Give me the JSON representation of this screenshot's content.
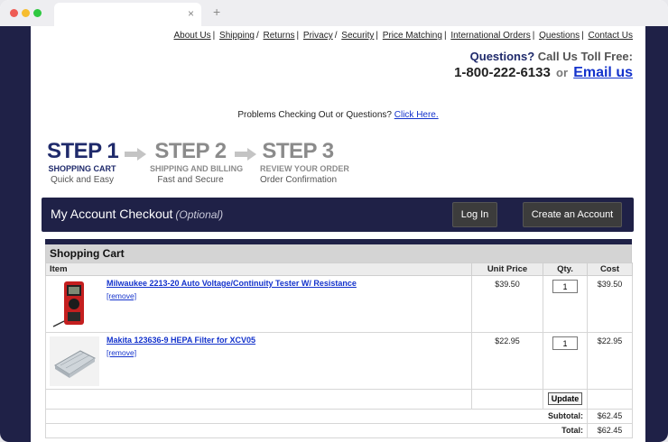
{
  "browser": {
    "tab_close": "×",
    "new_tab": "+"
  },
  "toplinks": [
    "About Us",
    "Shipping",
    "Returns",
    "Privacy",
    "Security",
    "Price Matching",
    "International Orders",
    "Questions",
    "Contact Us"
  ],
  "toll": {
    "questions": "Questions?",
    "call_text": " Call Us Toll Free:",
    "phone": "1-800-222-6133",
    "or": "or",
    "email_link": "Email us"
  },
  "problems": {
    "text": "Problems Checking Out or Questions? ",
    "link": "Click Here."
  },
  "steps": [
    {
      "big": "STEP 1",
      "sub": "SHOPPING CART",
      "desc": "Quick and Easy"
    },
    {
      "big": "STEP 2",
      "sub": "SHIPPING AND BILLING",
      "desc": "Fast and Secure"
    },
    {
      "big": "STEP 3",
      "sub": "REVIEW YOUR ORDER",
      "desc": "Order Confirmation"
    }
  ],
  "account": {
    "title": "My Account Checkout",
    "optional": "(Optional)",
    "login_label": "Log In",
    "create_label": "Create an Account"
  },
  "cart": {
    "title": "Shopping Cart",
    "headers": {
      "item": "Item",
      "unit_price": "Unit Price",
      "qty": "Qty.",
      "cost": "Cost"
    },
    "items": [
      {
        "name": "Milwaukee 2213-20 Auto Voltage/Continuity Tester W/ Resistance",
        "remove": "[remove]",
        "unit_price": "$39.50",
        "qty": "1",
        "cost": "$39.50"
      },
      {
        "name": "Makita 123636-9 HEPA Filter for XCV05",
        "remove": "[remove]",
        "unit_price": "$22.95",
        "qty": "1",
        "cost": "$22.95"
      }
    ],
    "update_label": "Update",
    "subtotal_label": "Subtotal:",
    "subtotal": "$62.45",
    "total_label": "Total:",
    "total": "$62.45"
  },
  "colors": {
    "navy": "#1f2147",
    "link_blue": "#1433cc",
    "step_active": "#1f2a6b",
    "step_inactive": "#8b8b8b"
  }
}
